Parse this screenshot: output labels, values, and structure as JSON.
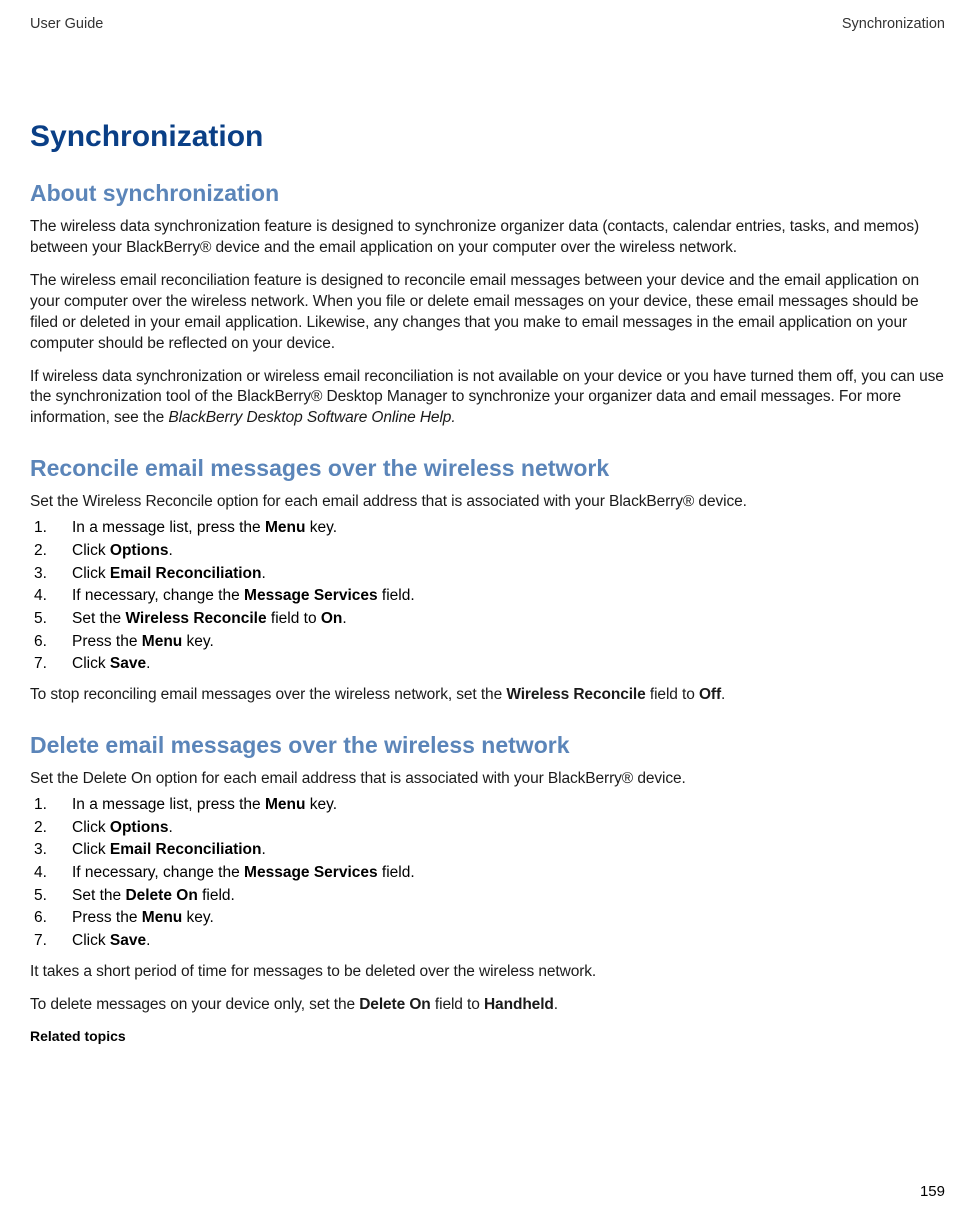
{
  "header": {
    "left": "User Guide",
    "right": "Synchronization"
  },
  "chapter_title": "Synchronization",
  "sections": {
    "about": {
      "title": "About synchronization",
      "p1": "The wireless data synchronization feature is designed to synchronize organizer data (contacts, calendar entries, tasks, and memos) between your BlackBerry® device and the email application on your computer over the wireless network.",
      "p2": "The wireless email reconciliation feature is designed to reconcile email messages between your device and the email application on your computer over the wireless network. When you file or delete email messages on your device, these email messages should be filed or deleted in your email application. Likewise, any changes that you make to email messages in the email application on your computer should be reflected on your device.",
      "p3_a": "If wireless data synchronization or wireless email reconciliation is not available on your device or you have turned them off, you can use the synchronization tool of the BlackBerry® Desktop Manager to synchronize your organizer data and email messages. For more information, see the ",
      "p3_i": " BlackBerry Desktop Software Online Help.",
      "p3_b": ""
    },
    "reconcile": {
      "title": "Reconcile email messages over the wireless network",
      "intro": "Set the Wireless Reconcile option for each email address that is associated with your BlackBerry® device.",
      "steps": [
        {
          "a": "In a message list, press the ",
          "b": "Menu",
          "c": " key."
        },
        {
          "a": "Click ",
          "b": "Options",
          "c": "."
        },
        {
          "a": "Click ",
          "b": "Email Reconciliation",
          "c": "."
        },
        {
          "a": "If necessary, change the ",
          "b": "Message Services",
          "c": " field."
        },
        {
          "a": "Set the ",
          "b": "Wireless Reconcile",
          "c": " field to ",
          "b2": "On",
          "c2": "."
        },
        {
          "a": "Press the ",
          "b": "Menu",
          "c": " key."
        },
        {
          "a": "Click ",
          "b": "Save",
          "c": "."
        }
      ],
      "outro_a": "To stop reconciling email messages over the wireless network, set the ",
      "outro_b": "Wireless Reconcile",
      "outro_c": " field to ",
      "outro_d": "Off",
      "outro_e": "."
    },
    "delete": {
      "title": "Delete email messages over the wireless network",
      "intro": "Set the Delete On option for each email address that is associated with your BlackBerry® device.",
      "steps": [
        {
          "a": "In a message list, press the ",
          "b": "Menu",
          "c": " key."
        },
        {
          "a": "Click ",
          "b": "Options",
          "c": "."
        },
        {
          "a": "Click ",
          "b": "Email Reconciliation",
          "c": "."
        },
        {
          "a": "If necessary, change the ",
          "b": "Message Services",
          "c": " field."
        },
        {
          "a": "Set the ",
          "b": "Delete On",
          "c": " field."
        },
        {
          "a": "Press the ",
          "b": "Menu",
          "c": " key."
        },
        {
          "a": "Click ",
          "b": "Save",
          "c": "."
        }
      ],
      "note": "It takes a short period of time for messages to be deleted over the wireless network.",
      "outro_a": "To delete messages on your device only, set the ",
      "outro_b": "Delete On",
      "outro_c": " field to ",
      "outro_d": "Handheld",
      "outro_e": ".",
      "related": "Related topics"
    }
  },
  "page_number": "159"
}
